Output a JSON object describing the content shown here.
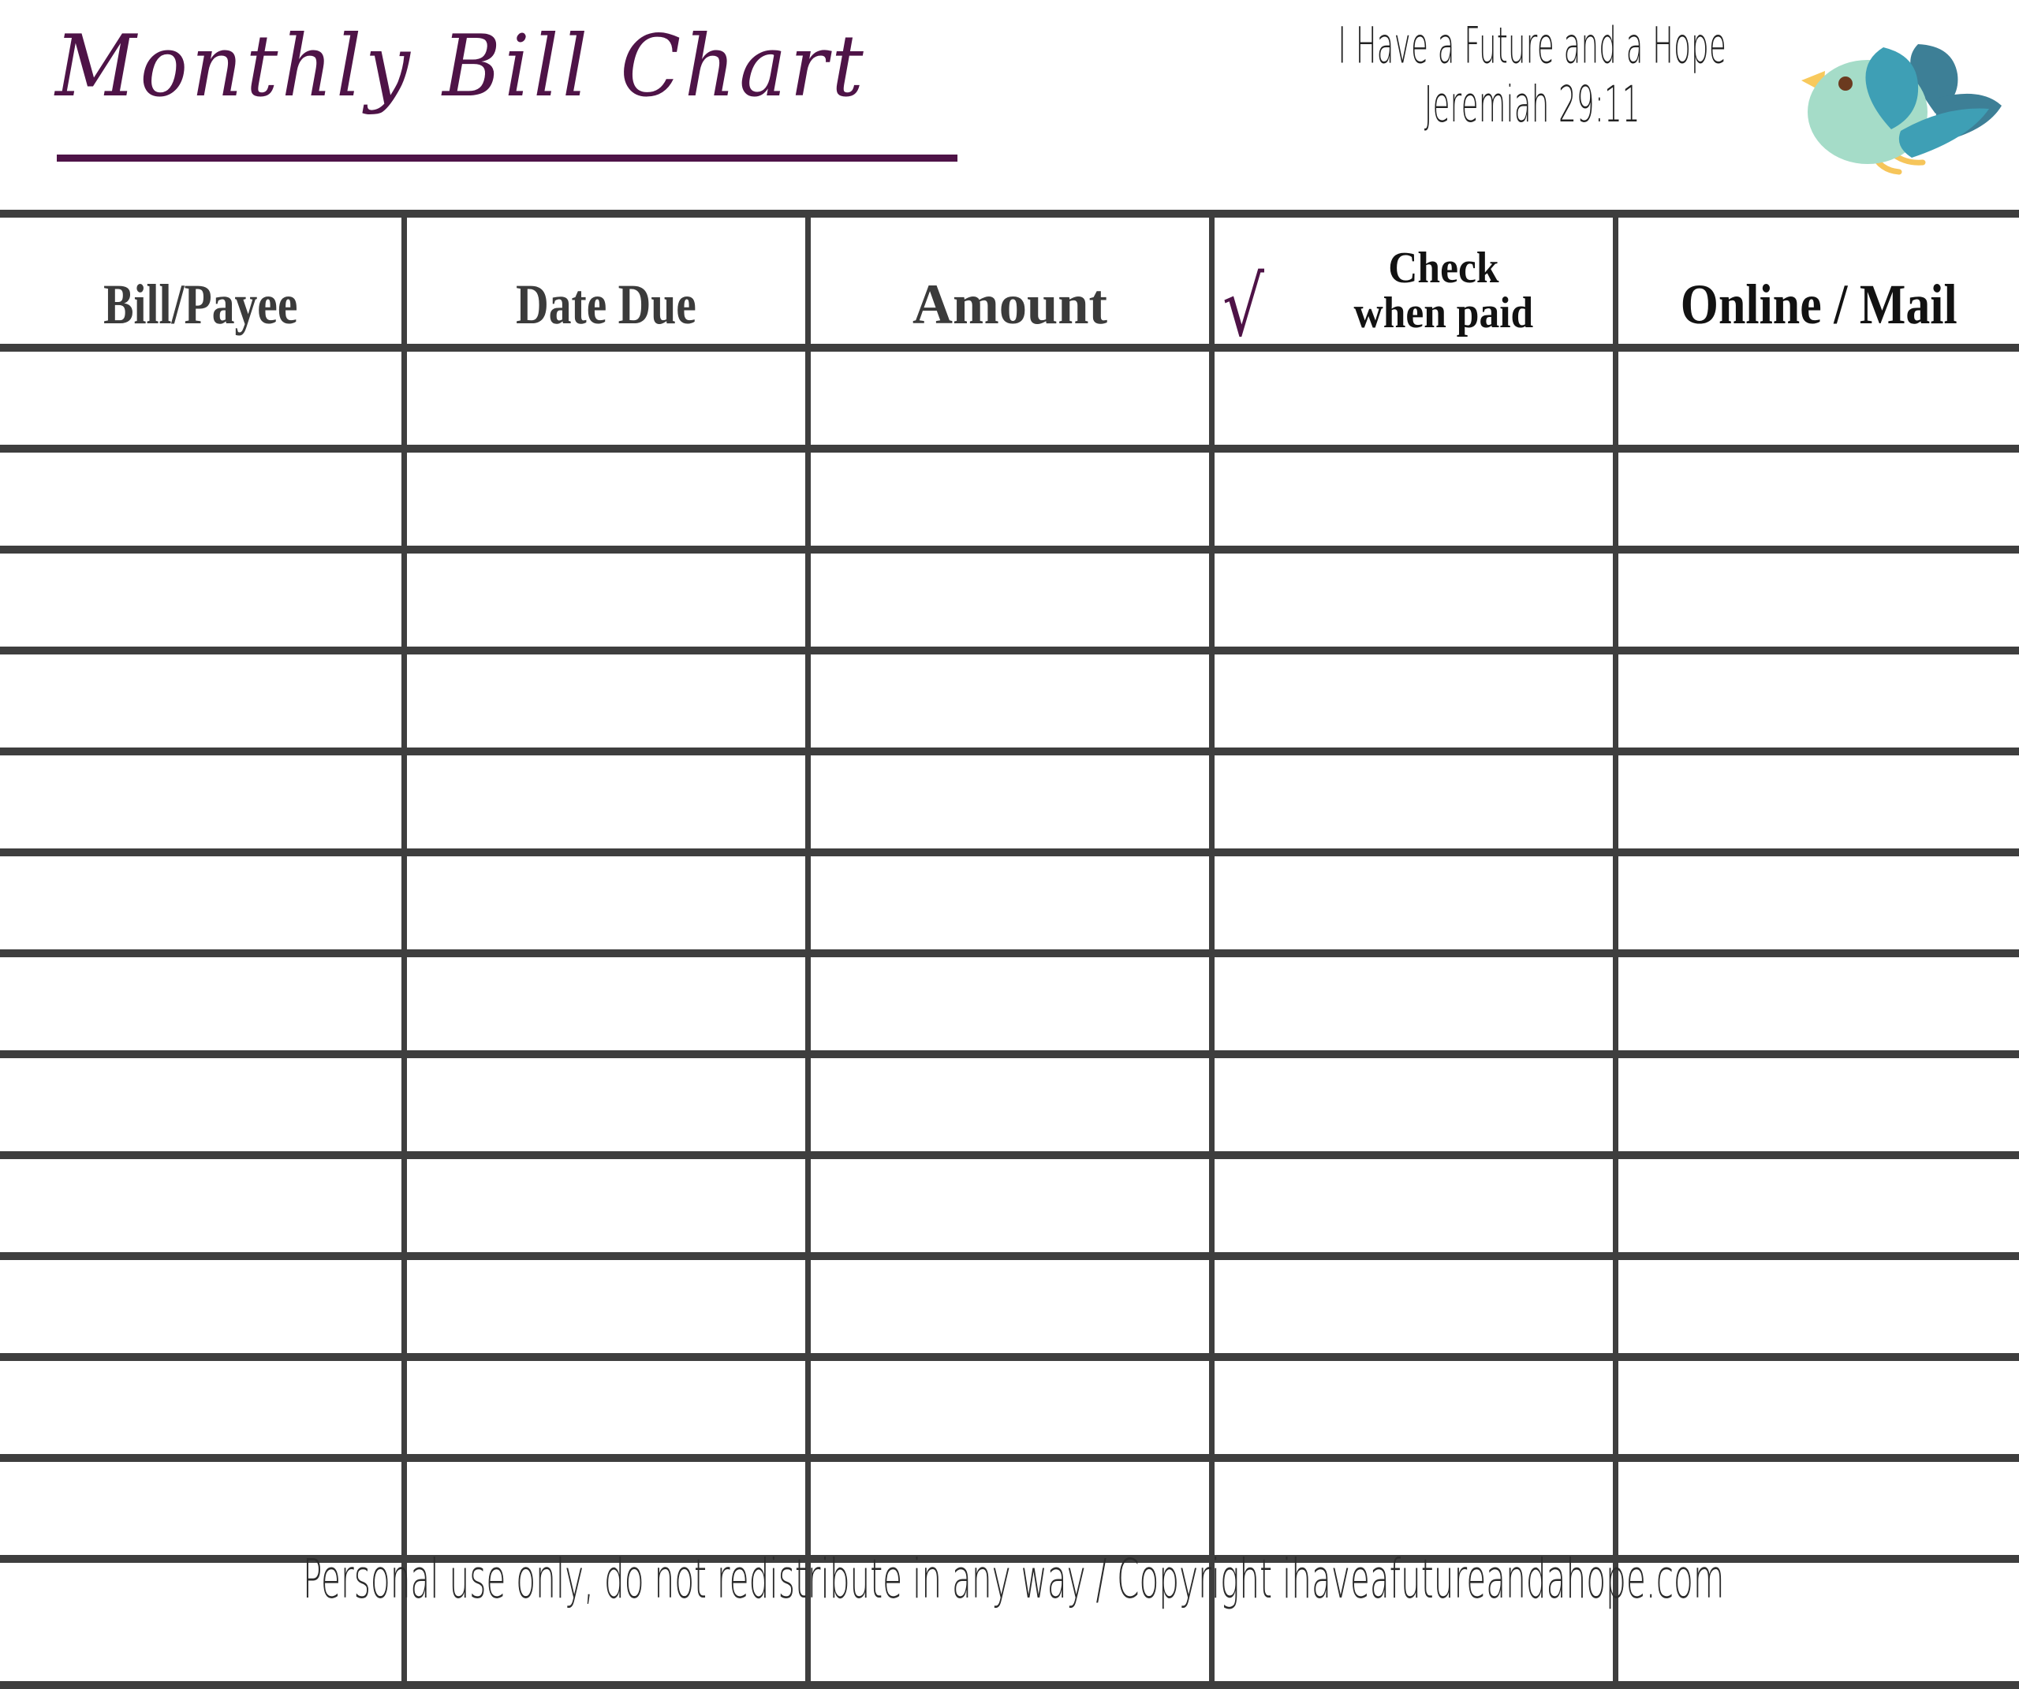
{
  "header": {
    "title": "Monthly Bill Chart",
    "tagline_line1": "I Have a Future and a Hope",
    "tagline_line2": "Jeremiah 29:11",
    "logo_icon": "bird-icon",
    "title_color": "#4e1347",
    "rule_color": "#4e1347"
  },
  "table": {
    "columns": [
      {
        "label": "Bill/Payee"
      },
      {
        "label": "Date Due"
      },
      {
        "label": "Amount"
      },
      {
        "label_line1": "Check",
        "label_line2": "when paid",
        "check_glyph": "√",
        "check_color": "#4e1347"
      },
      {
        "label": "Online / Mail"
      }
    ],
    "row_count": 13,
    "rows": [
      {
        "bill_payee": "",
        "date_due": "",
        "amount": "",
        "check_when_paid": "",
        "online_mail": ""
      },
      {
        "bill_payee": "",
        "date_due": "",
        "amount": "",
        "check_when_paid": "",
        "online_mail": ""
      },
      {
        "bill_payee": "",
        "date_due": "",
        "amount": "",
        "check_when_paid": "",
        "online_mail": ""
      },
      {
        "bill_payee": "",
        "date_due": "",
        "amount": "",
        "check_when_paid": "",
        "online_mail": ""
      },
      {
        "bill_payee": "",
        "date_due": "",
        "amount": "",
        "check_when_paid": "",
        "online_mail": ""
      },
      {
        "bill_payee": "",
        "date_due": "",
        "amount": "",
        "check_when_paid": "",
        "online_mail": ""
      },
      {
        "bill_payee": "",
        "date_due": "",
        "amount": "",
        "check_when_paid": "",
        "online_mail": ""
      },
      {
        "bill_payee": "",
        "date_due": "",
        "amount": "",
        "check_when_paid": "",
        "online_mail": ""
      },
      {
        "bill_payee": "",
        "date_due": "",
        "amount": "",
        "check_when_paid": "",
        "online_mail": ""
      },
      {
        "bill_payee": "",
        "date_due": "",
        "amount": "",
        "check_when_paid": "",
        "online_mail": ""
      },
      {
        "bill_payee": "",
        "date_due": "",
        "amount": "",
        "check_when_paid": "",
        "online_mail": ""
      },
      {
        "bill_payee": "",
        "date_due": "",
        "amount": "",
        "check_when_paid": "",
        "online_mail": ""
      },
      {
        "bill_payee": "",
        "date_due": "",
        "amount": "",
        "check_when_paid": "",
        "online_mail": ""
      }
    ],
    "grid_color": "#3e3e3e",
    "header_text_color": "#3b3b3b"
  },
  "footer": {
    "note": "Personal use only, do not redistribute in any way / Copyright ihaveafutureandahope.com"
  },
  "logo_colors": {
    "body": "#a5dcc8",
    "wing_front": "#3e9fb5",
    "wing_back": "#3d7f96",
    "beak": "#f8c95c",
    "legs": "#f6c55a",
    "eye": "#6b3a1f"
  }
}
